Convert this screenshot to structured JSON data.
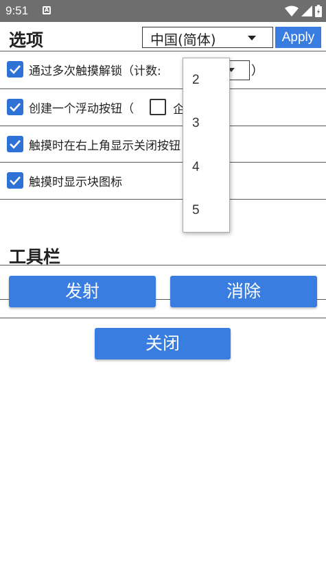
{
  "status_bar": {
    "time": "9:51",
    "notification_icon": "A"
  },
  "options": {
    "title": "选项",
    "language_select": {
      "selected": "中国(简体)"
    },
    "apply_label": "Apply",
    "items": [
      {
        "label": "通过多次触摸解锁（计数:",
        "checked": true
      },
      {
        "label": "创建一个浮动按钮（",
        "checked": true
      },
      {
        "label": "触摸时在右上角显示关闭按钮",
        "checked": true
      },
      {
        "label": "触摸时显示块图标",
        "checked": true
      }
    ],
    "count_close_paren": "）",
    "floating_option": {
      "open_paren": "（",
      "label": "企",
      "checked": false
    }
  },
  "count_dropdown": {
    "options": [
      "2",
      "3",
      "4",
      "5"
    ]
  },
  "toolbar": {
    "title": "工具栏",
    "fire_label": "发射",
    "clear_label": "消除"
  },
  "close_label": "关闭",
  "colors": {
    "accent": "#3a7de0",
    "checkbox": "#2f72d6",
    "statusbar": "#6e6e6e"
  }
}
